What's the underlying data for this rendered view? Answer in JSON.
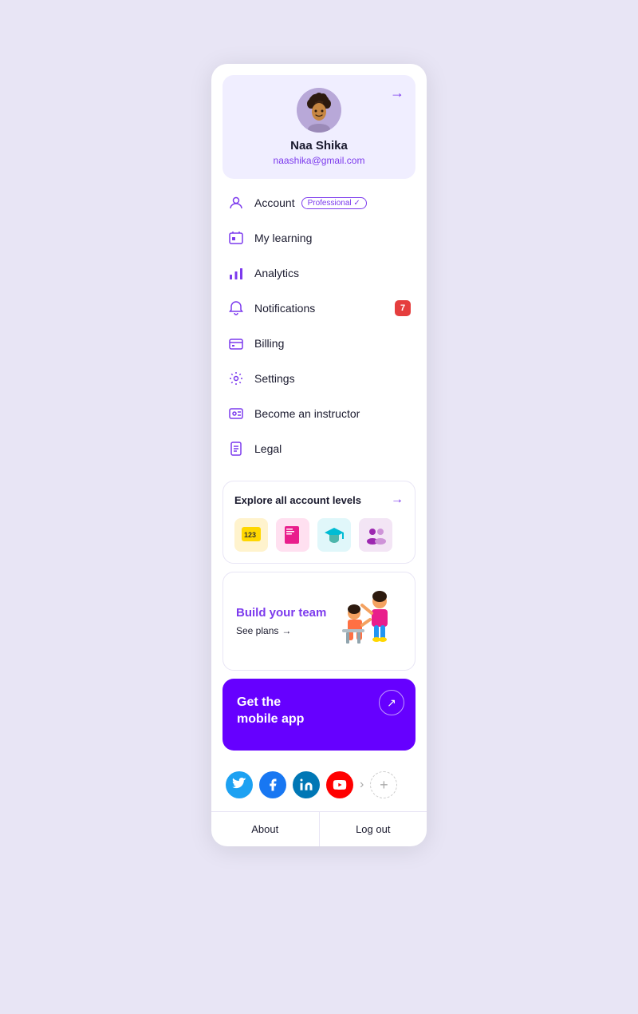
{
  "profile": {
    "name": "Naa Shika",
    "email": "naashika@gmail.com",
    "badge": "Professional ✓"
  },
  "menu": {
    "items": [
      {
        "id": "account",
        "label": "Account",
        "hasBadge": true,
        "badgeText": "Professional ✓"
      },
      {
        "id": "my-learning",
        "label": "My learning",
        "hasBadge": false
      },
      {
        "id": "analytics",
        "label": "Analytics",
        "hasBadge": false
      },
      {
        "id": "notifications",
        "label": "Notifications",
        "hasBadge": false,
        "count": "7"
      },
      {
        "id": "billing",
        "label": "Billing",
        "hasBadge": false
      },
      {
        "id": "settings",
        "label": "Settings",
        "hasBadge": false
      },
      {
        "id": "become-instructor",
        "label": "Become an instructor",
        "hasBadge": false
      },
      {
        "id": "legal",
        "label": "Legal",
        "hasBadge": false
      }
    ]
  },
  "explore": {
    "title": "Explore all account levels",
    "arrow": "→"
  },
  "build_team": {
    "title": "Build your team",
    "link": "See plans",
    "link_arrow": "→"
  },
  "mobile_app": {
    "title": "Get the\nmobile app",
    "btn_icon": "↗"
  },
  "social": {
    "chevron": "›",
    "add_icon": "+"
  },
  "footer": {
    "about": "About",
    "logout": "Log out"
  }
}
